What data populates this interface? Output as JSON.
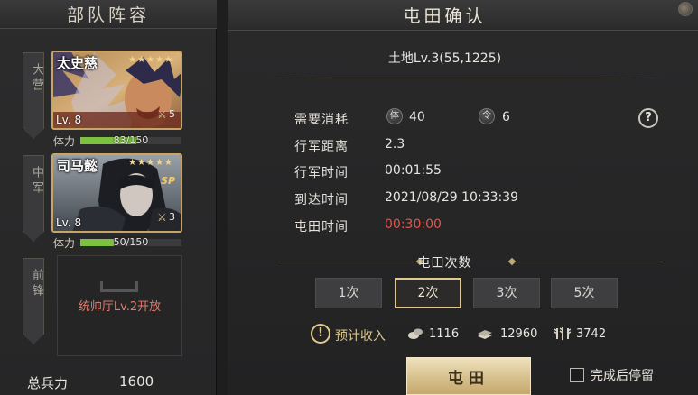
{
  "left": {
    "title": "部队阵容",
    "slots": [
      {
        "tag": "大营",
        "hero": {
          "name": "太史慈",
          "stars": "★★★★★",
          "level": "Lv. 8",
          "badge": "5",
          "sp": "",
          "stamina_label": "体力",
          "stamina_text": "83/150",
          "stamina_fraction": 0.55
        }
      },
      {
        "tag": "中军",
        "hero": {
          "name": "司马懿",
          "stars": "★★★★★",
          "level": "Lv. 8",
          "badge": "3",
          "sp": "SP",
          "stamina_label": "体力",
          "stamina_text": "50/150",
          "stamina_fraction": 0.33
        }
      },
      {
        "tag": "前锋",
        "locked_text": "统帅厅Lv.2开放"
      }
    ],
    "total_troops_label": "总兵力",
    "total_troops_value": "1600"
  },
  "right": {
    "title": "屯田确认",
    "land": "土地Lv.3(55,1225)",
    "cost": {
      "label": "需要消耗",
      "stamina_icon": "体",
      "stamina_value": "40",
      "order_icon": "令",
      "order_value": "6"
    },
    "rows": [
      {
        "label": "行军距离",
        "value": "2.3"
      },
      {
        "label": "行军时间",
        "value": "00:01:55"
      },
      {
        "label": "到达时间",
        "value": "2021/08/29 10:33:39"
      },
      {
        "label": "屯田时间",
        "value": "00:30:00"
      }
    ],
    "count_title": "屯田次数",
    "count_options": [
      "1次",
      "2次",
      "3次",
      "5次"
    ],
    "selected_count_index": 1,
    "income": {
      "label": "预计收入",
      "wood": "1116",
      "stone": "12960",
      "grain": "3742"
    },
    "confirm_button": "屯田",
    "stop_after_label": "完成后停留",
    "stop_after_checked": false
  },
  "colors": {
    "accent_gold": "#e0c98a",
    "stamina_green": "#7bc23f",
    "warning_red": "#e0564a"
  }
}
